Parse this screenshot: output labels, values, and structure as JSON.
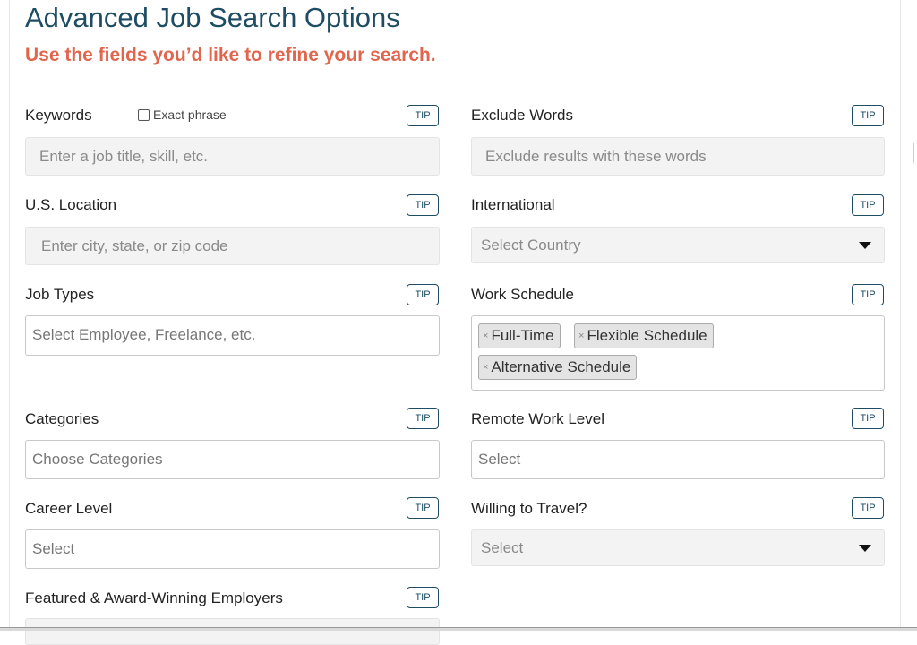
{
  "header": {
    "title": "Advanced Job Search Options",
    "subtitle": "Use the fields you’d like to refine your search."
  },
  "tip_label": "TIP",
  "fields": {
    "keywords": {
      "label": "Keywords",
      "exact_phrase_label": "Exact phrase",
      "exact_phrase_checked": false,
      "placeholder": "Enter a job title, skill, etc."
    },
    "exclude_words": {
      "label": "Exclude Words",
      "placeholder": "Exclude results with these words"
    },
    "us_location": {
      "label": "U.S. Location",
      "placeholder": "Enter city, state, or zip code"
    },
    "international": {
      "label": "International",
      "placeholder": "Select Country"
    },
    "job_types": {
      "label": "Job Types",
      "placeholder": "Select Employee, Freelance, etc."
    },
    "work_schedule": {
      "label": "Work Schedule",
      "tags": [
        "Full-Time",
        "Flexible Schedule",
        "Alternative Schedule"
      ],
      "remove_glyph": "×"
    },
    "categories": {
      "label": "Categories",
      "placeholder": "Choose Categories"
    },
    "remote_work_level": {
      "label": "Remote Work Level",
      "placeholder": "Select"
    },
    "career_level": {
      "label": "Career Level",
      "placeholder": "Select"
    },
    "willing_to_travel": {
      "label": "Willing to Travel?",
      "placeholder": "Select"
    },
    "featured_employers": {
      "label": "Featured & Award-Winning Employers"
    }
  },
  "icons": {
    "dropdown": "caret-down-icon",
    "tag_remove": "close-icon"
  },
  "colors": {
    "title": "#1e4d63",
    "subtitle": "#e2654d",
    "tip_border": "#1e4d63",
    "input_gray_bg": "#f3f3f3"
  }
}
